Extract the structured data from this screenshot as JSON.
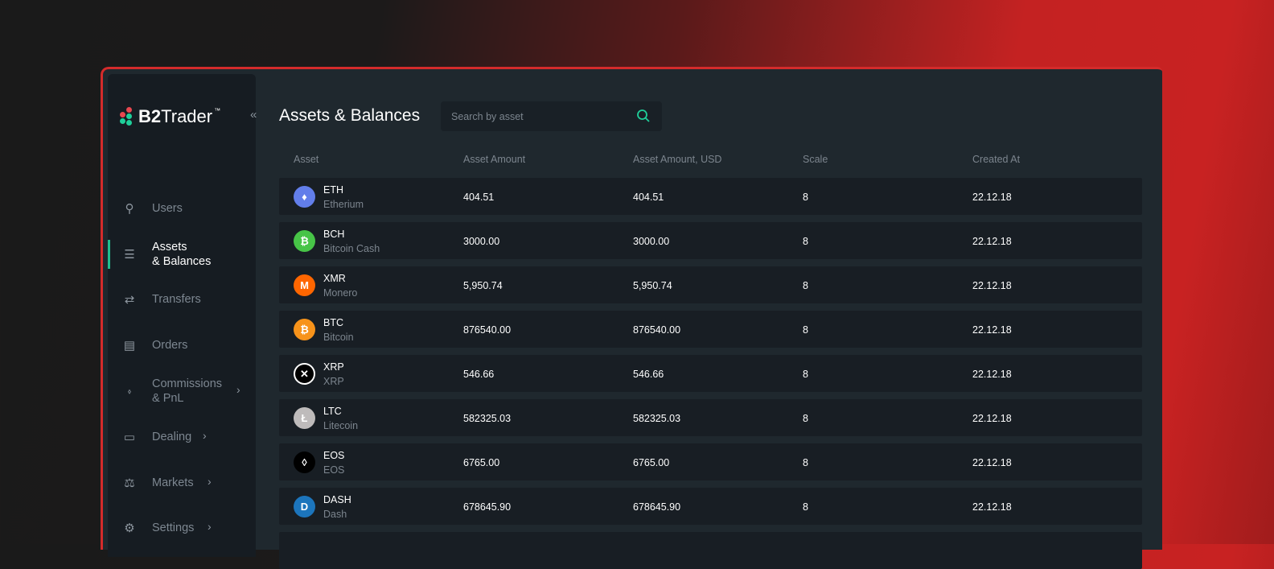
{
  "brand": {
    "name_bold": "B2",
    "name_rest": "Trader",
    "tm": "™"
  },
  "sidebar": {
    "collapse": "«",
    "items": [
      {
        "label": "Users",
        "icon": "user-list-icon"
      },
      {
        "label": "Assets",
        "label2": "& Balances",
        "icon": "coins-stack-icon",
        "active": true
      },
      {
        "label": "Transfers",
        "icon": "transfer-arrows-icon"
      },
      {
        "label": "Orders",
        "icon": "orders-icon"
      },
      {
        "label": "Commissions",
        "label2": "& PnL",
        "icon": "tag-icon",
        "chevron": "›"
      },
      {
        "label": "Dealing",
        "icon": "monitor-icon",
        "chevron": "›"
      },
      {
        "label": "Markets",
        "icon": "scales-icon",
        "chevron": "›"
      },
      {
        "label": "Settings",
        "icon": "gear-icon",
        "chevron": "›"
      }
    ]
  },
  "page": {
    "title": "Assets & Balances",
    "search_placeholder": "Search by asset"
  },
  "table": {
    "headers": [
      "Asset",
      "Asset Amount",
      "Asset Amount, USD",
      "Scale",
      "Created At"
    ],
    "rows": [
      {
        "symbol": "ETH",
        "name": "Etherium",
        "amount": "404.51",
        "usd": "404.51",
        "scale": "8",
        "created": "22.12.18",
        "color": "#627eea",
        "glyph": "♦"
      },
      {
        "symbol": "BCH",
        "name": "Bitcoin Cash",
        "amount": "3000.00",
        "usd": "3000.00",
        "scale": "8",
        "created": "22.12.18",
        "color": "#47c447",
        "glyph": "₿"
      },
      {
        "symbol": "XMR",
        "name": "Monero",
        "amount": "5,950.74",
        "usd": "5,950.74",
        "scale": "8",
        "created": "22.12.18",
        "color": "#ff6600",
        "glyph": "M"
      },
      {
        "symbol": "BTC",
        "name": "Bitcoin",
        "amount": "876540.00",
        "usd": "876540.00",
        "scale": "8",
        "created": "22.12.18",
        "color": "#f7931a",
        "glyph": "₿"
      },
      {
        "symbol": "XRP",
        "name": "XRP",
        "amount": "546.66",
        "usd": "546.66",
        "scale": "8",
        "created": "22.12.18",
        "color": "#000000",
        "glyph": "✕"
      },
      {
        "symbol": "LTC",
        "name": "Litecoin",
        "amount": "582325.03",
        "usd": "582325.03",
        "scale": "8",
        "created": "22.12.18",
        "color": "#bebbbb",
        "glyph": "Ł"
      },
      {
        "symbol": "EOS",
        "name": "EOS",
        "amount": "6765.00",
        "usd": "6765.00",
        "scale": "8",
        "created": "22.12.18",
        "color": "#000000",
        "glyph": "◊"
      },
      {
        "symbol": "DASH",
        "name": "Dash",
        "amount": "678645.90",
        "usd": "678645.90",
        "scale": "8",
        "created": "22.12.18",
        "color": "#1c75bc",
        "glyph": "D"
      }
    ]
  }
}
